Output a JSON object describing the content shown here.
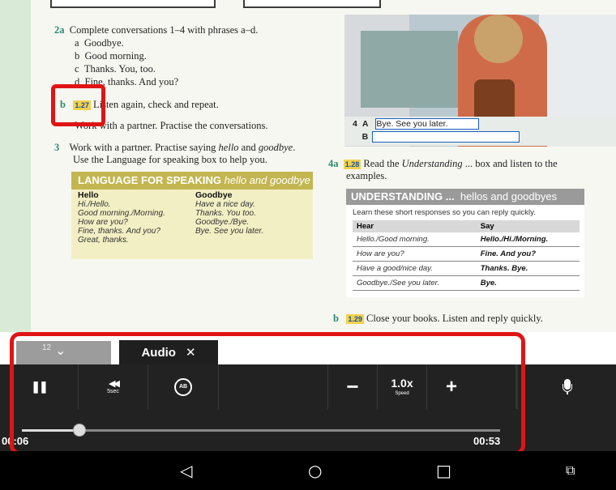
{
  "exercise_2a": {
    "number": "2a",
    "instruction": "Complete conversations 1–4 with phrases a–d.",
    "options": [
      {
        "letter": "a",
        "text": "Goodbye."
      },
      {
        "letter": "b",
        "text": "Good morning."
      },
      {
        "letter": "c",
        "text": "Thanks. You, too."
      },
      {
        "letter": "d",
        "text": "Fine, thanks. And you?"
      }
    ]
  },
  "exercise_2b": {
    "letter": "b",
    "audio": "1.27",
    "text": "Listen again, check and repeat."
  },
  "exercise_2c": {
    "text": "Work with a partner. Practise the conversations."
  },
  "exercise_3": {
    "number": "3",
    "line1_a": "Work with a partner. Practise saying ",
    "line1_hello": "hello",
    "line1_and": " and ",
    "line1_goodbye": "goodbye",
    "line1_end": ".",
    "line2": "Use the Language for speaking box to help you."
  },
  "language_box": {
    "title": "LANGUAGE FOR SPEAKING",
    "subtitle": "hello and goodbye",
    "col1_header": "Hello",
    "col1_items": [
      "Hi./Hello.",
      "Good morning./Morning.",
      "How are you?",
      "Fine, thanks. And you?",
      "Great, thanks."
    ],
    "col2_header": "Goodbye",
    "col2_items": [
      "Have a nice day.",
      "Thanks. You too.",
      "Goodbye./Bye.",
      "Bye. See you later."
    ]
  },
  "photo_caption": {
    "number": "4",
    "speaker_a": "A",
    "line_a": "Bye. See you later.",
    "speaker_b": "B"
  },
  "exercise_4a": {
    "number": "4a",
    "audio": "1.28",
    "text_a": "Read the ",
    "text_italic": "Understanding",
    "text_b": " ... box and listen to the",
    "text_line2": "examples."
  },
  "understanding_box": {
    "title": "UNDERSTANDING ...",
    "subtitle": "hellos and goodbyes",
    "intro": "Learn these short responses so you can reply quickly.",
    "headers": [
      "Hear",
      "Say"
    ],
    "rows": [
      [
        "Hello./Good morning.",
        "Hello./Hi./Morning."
      ],
      [
        "How are you?",
        "Fine. And you?"
      ],
      [
        "Have a good/nice day.",
        "Thanks. Bye."
      ],
      [
        "Goodbye./See you later.",
        "Bye."
      ]
    ]
  },
  "exercise_4b": {
    "letter": "b",
    "audio": "1.29",
    "text": "Close your books. Listen and reply quickly."
  },
  "tabs": {
    "page_number": "12",
    "audio_label": "Audio",
    "close_glyph": "✕",
    "collapse_glyph": "⌄"
  },
  "player": {
    "pause_glyph": "❚❚",
    "rewind_glyph": "◀◀",
    "rewind_label": "5sec",
    "ab_label": "AB",
    "minus_glyph": "−",
    "speed_value": "1.0x",
    "speed_label": "Speed",
    "plus_glyph": "+",
    "mic_glyph": "🎙",
    "current_time": "00:06",
    "total_time": "00:53",
    "progress": 0.12
  },
  "navbar": {
    "back": "◁",
    "home": "○",
    "recents": "□",
    "extra": "⧉"
  },
  "colors": {
    "highlight_red": "#e01414",
    "player_bg": "#222222",
    "tab_active": "#1f1f1f"
  }
}
